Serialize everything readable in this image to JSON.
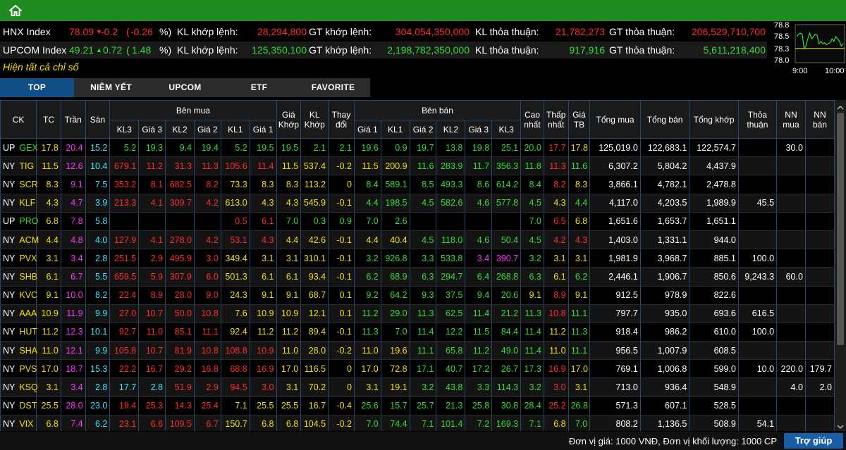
{
  "colors": {
    "up": "#33dd33",
    "down": "#ff2a2a",
    "ref": "#f0e000",
    "ceil": "#ff33ff",
    "floor": "#33e6ff",
    "neutral": "#ffffff",
    "accent": "#1f8a1f"
  },
  "icons": {
    "home": "home-icon"
  },
  "indices": [
    {
      "name": "HNX Index",
      "value": "78.09",
      "arrow": "▼",
      "change": "-0.2",
      "open_paren": "(",
      "pct": "-0.26",
      "pct_suffix": "%)",
      "kl_khop_label": "KL khớp lệnh:",
      "kl_khop": "28,294,800",
      "gt_khop_label": "GT khớp lệnh:",
      "gt_khop": "304,054,350,000",
      "kl_tt_label": "KL thỏa thuận:",
      "kl_tt": "21,782,273",
      "gt_tt_label": "GT thỏa thuận:",
      "gt_tt": "206,529,710,700",
      "dir": "down"
    },
    {
      "name": "UPCOM Index",
      "value": "49.21",
      "arrow": "▲",
      "change": "0.72",
      "open_paren": "(",
      "pct": "1.48",
      "pct_suffix": "%)",
      "kl_khop_label": "KL khớp lệnh:",
      "kl_khop": "125,350,100",
      "gt_khop_label": "GT khớp lệnh:",
      "gt_khop": "2,198,782,350,000",
      "kl_tt_label": "KL thỏa thuận:",
      "kl_tt": "917,916",
      "gt_tt_label": "GT thỏa thuận:",
      "gt_tt": "5,611,218,400",
      "dir": "up"
    }
  ],
  "show_all": "Hiện tất cả chỉ số",
  "mini_chart": {
    "y_labels": [
      "78.8",
      "78.5",
      "78.3",
      "78.0"
    ],
    "x_labels": [
      "9:00",
      "10:00"
    ],
    "series": [
      78.55,
      78.6,
      78.62,
      78.6,
      78.3,
      78.35,
      78.5,
      78.62,
      78.5,
      78.55,
      78.6,
      78.58,
      78.4,
      78.45,
      78.4,
      78.42,
      78.38,
      78.4,
      78.42,
      78.5,
      78.45,
      78.55,
      78.5,
      78.45,
      78.35,
      78.4
    ],
    "ref": 78.3,
    "y_range": [
      78.0,
      78.8
    ]
  },
  "tabs": [
    "TOP",
    "NIÊM YẾT",
    "UPCOM",
    "ETF",
    "FAVORITE"
  ],
  "headers": {
    "ck": "CK",
    "tc": "TC",
    "tran": "Trần",
    "san": "Sàn",
    "ben_mua": "Bên mua",
    "ben_ban": "Bên bán",
    "buy_sub": [
      "KL3",
      "Giá 3",
      "KL2",
      "Giá 2",
      "KL1",
      "Giá 1"
    ],
    "gia_khop": "Giá Khớp",
    "kl_khop": "KL Khớp",
    "thay_doi": "Thay đổi",
    "sell_sub": [
      "Giá 1",
      "KL1",
      "Giá 2",
      "KL2",
      "Giá 3",
      "KL3"
    ],
    "cao_nhat": "Cao nhất",
    "thap_nhat": "Thấp nhất",
    "gia_tb": "Giá TB",
    "tong_mua": "Tổng mua",
    "tong_ban": "Tổng bán",
    "tong_khop": "Tổng khớp",
    "thoa_thuan": "Thỏa thuận",
    "nn_mua": "NN mua",
    "nn_ban": "NN bán"
  },
  "rows": [
    {
      "ex": "UP",
      "ck": "GEX",
      "tc": "17.8",
      "tran": "20.4",
      "san": "15.2",
      "b": [
        "5.2",
        "19.3",
        "9.4",
        "19.4",
        "5.2",
        "19.5"
      ],
      "bc": [
        "g",
        "g",
        "g",
        "g",
        "g",
        "g"
      ],
      "gk": "19.5",
      "kk": "2.1",
      "td": "2.1",
      "kc": "g",
      "s": [
        "19.6",
        "0.9",
        "19.7",
        "13.8",
        "19.8",
        "25.1"
      ],
      "sc": [
        "g",
        "g",
        "g",
        "g",
        "g",
        "g"
      ],
      "cao": "20.0",
      "caoc": "g",
      "thap": "17.7",
      "thapc": "r",
      "tb": "17.8",
      "tbc": "y",
      "tm": "125,019.0",
      "tbn": "122,683.1",
      "tk": "122,574.7",
      "tt": "",
      "nm": "30.0",
      "nb": ""
    },
    {
      "ex": "NY",
      "ck": "TIG",
      "tc": "11.5",
      "tran": "12.6",
      "san": "10.4",
      "b": [
        "679.1",
        "11.2",
        "31.3",
        "11.3",
        "105.6",
        "11.4"
      ],
      "bc": [
        "r",
        "r",
        "r",
        "r",
        "r",
        "r"
      ],
      "gk": "11.5",
      "kk": "537.4",
      "td": "-0.2",
      "kc": "y",
      "s": [
        "11.5",
        "200.9",
        "11.6",
        "283.9",
        "11.7",
        "356.3"
      ],
      "sc": [
        "y",
        "y",
        "g",
        "g",
        "g",
        "g"
      ],
      "cao": "11.8",
      "caoc": "g",
      "thap": "11.3",
      "thapc": "r",
      "tb": "11.6",
      "tbc": "g",
      "tm": "6,307.2",
      "tbn": "5,804.2",
      "tk": "4,437.9",
      "tt": "",
      "nm": "",
      "nb": ""
    },
    {
      "ex": "NY",
      "ck": "SCR",
      "tc": "8.3",
      "tran": "9.1",
      "san": "7.5",
      "b": [
        "353.2",
        "8.1",
        "682.5",
        "8.2",
        "73.3",
        "8.3"
      ],
      "bc": [
        "r",
        "r",
        "r",
        "r",
        "y",
        "y"
      ],
      "gk": "8.3",
      "kk": "113.2",
      "td": "0",
      "kc": "y",
      "s": [
        "8.4",
        "589.1",
        "8.5",
        "493.3",
        "8.6",
        "614.2"
      ],
      "sc": [
        "g",
        "g",
        "g",
        "g",
        "g",
        "g"
      ],
      "cao": "8.4",
      "caoc": "g",
      "thap": "8.2",
      "thapc": "r",
      "tb": "8.3",
      "tbc": "y",
      "tm": "3,866.1",
      "tbn": "4,782.1",
      "tk": "2,478.8",
      "tt": "",
      "nm": "",
      "nb": ""
    },
    {
      "ex": "NY",
      "ck": "KLF",
      "tc": "4.3",
      "tran": "4.7",
      "san": "3.9",
      "b": [
        "213.3",
        "4.1",
        "309.7",
        "4.2",
        "613.0",
        "4.3"
      ],
      "bc": [
        "r",
        "r",
        "r",
        "r",
        "y",
        "y"
      ],
      "gk": "4.3",
      "kk": "545.9",
      "td": "-0.1",
      "kc": "y",
      "s": [
        "4.4",
        "198.5",
        "4.5",
        "582.6",
        "4.6",
        "577.8"
      ],
      "sc": [
        "g",
        "g",
        "g",
        "g",
        "g",
        "g"
      ],
      "cao": "4.5",
      "caoc": "g",
      "thap": "4.3",
      "thapc": "y",
      "tb": "4.4",
      "tbc": "g",
      "tm": "4,117.0",
      "tbn": "4,203.5",
      "tk": "1,989.9",
      "tt": "45.5",
      "nm": "",
      "nb": ""
    },
    {
      "ex": "UP",
      "ck": "PRO",
      "tc": "6.8",
      "tran": "7.8",
      "san": "5.8",
      "b": [
        "",
        "",
        "",
        "",
        "0.5",
        "6.1"
      ],
      "bc": [
        "r",
        "r",
        "r",
        "r",
        "r",
        "r"
      ],
      "gk": "7.0",
      "kk": "0.3",
      "td": "0.9",
      "kc": "g",
      "s": [
        "7.0",
        "2.6",
        "",
        "",
        "",
        ""
      ],
      "sc": [
        "g",
        "g",
        "g",
        "g",
        "g",
        "g"
      ],
      "cao": "7.0",
      "caoc": "g",
      "thap": "6.5",
      "thapc": "r",
      "tb": "6.8",
      "tbc": "y",
      "tm": "1,651.6",
      "tbn": "1,653.7",
      "tk": "1,651.1",
      "tt": "",
      "nm": "",
      "nb": ""
    },
    {
      "ex": "NY",
      "ck": "ACM",
      "tc": "4.4",
      "tran": "4.8",
      "san": "4.0",
      "b": [
        "127.9",
        "4.1",
        "278.0",
        "4.2",
        "53.1",
        "4.3"
      ],
      "bc": [
        "r",
        "r",
        "r",
        "r",
        "r",
        "r"
      ],
      "gk": "4.4",
      "kk": "42.6",
      "td": "-0.1",
      "kc": "y",
      "s": [
        "4.4",
        "40.4",
        "4.5",
        "118.0",
        "4.6",
        "50.4"
      ],
      "sc": [
        "y",
        "y",
        "g",
        "g",
        "g",
        "g"
      ],
      "cao": "4.5",
      "caoc": "g",
      "thap": "4.2",
      "thapc": "r",
      "tb": "4.3",
      "tbc": "r",
      "tm": "1,403.0",
      "tbn": "1,331.1",
      "tk": "944.0",
      "tt": "",
      "nm": "",
      "nb": ""
    },
    {
      "ex": "NY",
      "ck": "PVX",
      "tc": "3.1",
      "tran": "3.4",
      "san": "2.8",
      "b": [
        "251.5",
        "2.9",
        "495.9",
        "3.0",
        "349.4",
        "3.1"
      ],
      "bc": [
        "r",
        "r",
        "r",
        "r",
        "y",
        "y"
      ],
      "gk": "3.1",
      "kk": "310.1",
      "td": "-0.1",
      "kc": "y",
      "s": [
        "3.2",
        "926.8",
        "3.3",
        "533.8",
        "3.4",
        "390.7"
      ],
      "sc": [
        "g",
        "g",
        "g",
        "g",
        "m",
        "m"
      ],
      "cao": "3.2",
      "caoc": "g",
      "thap": "3.1",
      "thapc": "y",
      "tb": "3.1",
      "tbc": "y",
      "tm": "1,981.9",
      "tbn": "3,968.7",
      "tk": "885.1",
      "tt": "100.0",
      "nm": "",
      "nb": ""
    },
    {
      "ex": "NY",
      "ck": "SHB",
      "tc": "6.1",
      "tran": "6.7",
      "san": "5.5",
      "b": [
        "659.5",
        "5.9",
        "307.9",
        "6.0",
        "501.3",
        "6.1"
      ],
      "bc": [
        "r",
        "r",
        "r",
        "r",
        "y",
        "y"
      ],
      "gk": "6.1",
      "kk": "93.4",
      "td": "-0.1",
      "kc": "y",
      "s": [
        "6.2",
        "68.9",
        "6.3",
        "294.7",
        "6.4",
        "268.8"
      ],
      "sc": [
        "g",
        "g",
        "g",
        "g",
        "g",
        "g"
      ],
      "cao": "6.3",
      "caoc": "g",
      "thap": "6.1",
      "thapc": "y",
      "tb": "6.2",
      "tbc": "g",
      "tm": "2,446.1",
      "tbn": "1,906.7",
      "tk": "850.6",
      "tt": "9,243.3",
      "nm": "60.0",
      "nb": ""
    },
    {
      "ex": "NY",
      "ck": "KVC",
      "tc": "9.1",
      "tran": "10.0",
      "san": "8.2",
      "b": [
        "22.4",
        "8.9",
        "28.0",
        "9.0",
        "24.3",
        "9.1"
      ],
      "bc": [
        "r",
        "r",
        "r",
        "r",
        "y",
        "y"
      ],
      "gk": "9.1",
      "kk": "68.7",
      "td": "0.1",
      "kc": "y",
      "s": [
        "9.2",
        "64.2",
        "9.3",
        "37.5",
        "9.4",
        "20.6"
      ],
      "sc": [
        "g",
        "g",
        "g",
        "g",
        "g",
        "g"
      ],
      "cao": "9.1",
      "caoc": "y",
      "thap": "8.9",
      "thapc": "r",
      "tb": "9.1",
      "tbc": "y",
      "tm": "912.5",
      "tbn": "978.9",
      "tk": "822.6",
      "tt": "",
      "nm": "",
      "nb": ""
    },
    {
      "ex": "NY",
      "ck": "AAA",
      "tc": "10.9",
      "tran": "11.9",
      "san": "9.9",
      "b": [
        "27.0",
        "10.7",
        "50.0",
        "10.8",
        "7.6",
        "10.9"
      ],
      "bc": [
        "r",
        "r",
        "r",
        "r",
        "y",
        "y"
      ],
      "gk": "10.9",
      "kk": "12.1",
      "td": "0.1",
      "kc": "y",
      "s": [
        "11.2",
        "29.0",
        "11.3",
        "62.5",
        "11.4",
        "21.2"
      ],
      "sc": [
        "g",
        "g",
        "g",
        "g",
        "g",
        "g"
      ],
      "cao": "11.3",
      "caoc": "g",
      "thap": "10.8",
      "thapc": "r",
      "tb": "11.1",
      "tbc": "g",
      "tm": "797.7",
      "tbn": "935.0",
      "tk": "693.6",
      "tt": "616.5",
      "nm": "",
      "nb": ""
    },
    {
      "ex": "NY",
      "ck": "HUT",
      "tc": "11.2",
      "tran": "12.3",
      "san": "10.1",
      "b": [
        "92.7",
        "11.0",
        "85.1",
        "11.1",
        "92.4",
        "11.2"
      ],
      "bc": [
        "r",
        "r",
        "r",
        "r",
        "y",
        "y"
      ],
      "gk": "11.2",
      "kk": "89.4",
      "td": "-0.1",
      "kc": "y",
      "s": [
        "11.3",
        "7.0",
        "11.4",
        "12.2",
        "11.5",
        "84.4"
      ],
      "sc": [
        "g",
        "g",
        "g",
        "g",
        "g",
        "g"
      ],
      "cao": "11.4",
      "caoc": "g",
      "thap": "11.2",
      "thapc": "y",
      "tb": "11.3",
      "tbc": "g",
      "tm": "918.4",
      "tbn": "986.2",
      "tk": "610.0",
      "tt": "100.0",
      "nm": "",
      "nb": ""
    },
    {
      "ex": "NY",
      "ck": "SHA",
      "tc": "11.0",
      "tran": "12.1",
      "san": "9.9",
      "b": [
        "105.8",
        "10.7",
        "81.9",
        "10.8",
        "108.8",
        "10.9"
      ],
      "bc": [
        "r",
        "r",
        "r",
        "r",
        "r",
        "r"
      ],
      "gk": "11.0",
      "kk": "28.0",
      "td": "-0.2",
      "kc": "y",
      "s": [
        "11.0",
        "19.6",
        "11.1",
        "65.8",
        "11.2",
        "49.0"
      ],
      "sc": [
        "y",
        "y",
        "g",
        "g",
        "g",
        "g"
      ],
      "cao": "11.4",
      "caoc": "g",
      "thap": "11.0",
      "thapc": "y",
      "tb": "11.1",
      "tbc": "g",
      "tm": "956.5",
      "tbn": "1,007.9",
      "tk": "608.5",
      "tt": "",
      "nm": "",
      "nb": ""
    },
    {
      "ex": "NY",
      "ck": "PVS",
      "tc": "17.0",
      "tran": "18.7",
      "san": "15.3",
      "b": [
        "22.2",
        "16.7",
        "29.2",
        "16.8",
        "68.8",
        "16.9"
      ],
      "bc": [
        "r",
        "r",
        "r",
        "r",
        "r",
        "r"
      ],
      "gk": "17.0",
      "kk": "116.5",
      "td": "0",
      "kc": "y",
      "s": [
        "17.0",
        "72.8",
        "17.1",
        "40.7",
        "17.2",
        "26.7"
      ],
      "sc": [
        "y",
        "y",
        "g",
        "g",
        "g",
        "g"
      ],
      "cao": "17.3",
      "caoc": "g",
      "thap": "16.9",
      "thapc": "r",
      "tb": "17.0",
      "tbc": "y",
      "tm": "769.1",
      "tbn": "1,006.8",
      "tk": "599.0",
      "tt": "10.0",
      "nm": "220.0",
      "nb": "179.7"
    },
    {
      "ex": "NY",
      "ck": "KSQ",
      "tc": "3.1",
      "tran": "3.4",
      "san": "2.8",
      "b": [
        "17.7",
        "2.8",
        "51.9",
        "2.9",
        "94.5",
        "3.0"
      ],
      "bc": [
        "c",
        "c",
        "r",
        "r",
        "r",
        "r"
      ],
      "gk": "3.1",
      "kk": "70.2",
      "td": "0",
      "kc": "y",
      "s": [
        "3.1",
        "19.1",
        "3.2",
        "43.8",
        "3.3",
        "114.3"
      ],
      "sc": [
        "y",
        "y",
        "g",
        "g",
        "g",
        "g"
      ],
      "cao": "3.2",
      "caoc": "g",
      "thap": "3.0",
      "thapc": "r",
      "tb": "3.1",
      "tbc": "y",
      "tm": "713.0",
      "tbn": "936.4",
      "tk": "548.9",
      "tt": "",
      "nm": "4.0",
      "nb": "2.0"
    },
    {
      "ex": "NY",
      "ck": "DST",
      "tc": "25.5",
      "tran": "28.0",
      "san": "23.0",
      "b": [
        "19.4",
        "25.3",
        "14.3",
        "25.4",
        "7.1",
        "25.5"
      ],
      "bc": [
        "r",
        "r",
        "r",
        "r",
        "y",
        "y"
      ],
      "gk": "25.5",
      "kk": "16.7",
      "td": "-0.4",
      "kc": "y",
      "s": [
        "25.6",
        "15.7",
        "25.7",
        "21.3",
        "25.8",
        "30.8"
      ],
      "sc": [
        "g",
        "g",
        "g",
        "g",
        "g",
        "g"
      ],
      "cao": "28.4",
      "caoc": "g",
      "thap": "25.2",
      "thapc": "r",
      "tb": "26.8",
      "tbc": "g",
      "tm": "571.3",
      "tbn": "607.1",
      "tk": "528.5",
      "tt": "",
      "nm": "",
      "nb": ""
    },
    {
      "ex": "NY",
      "ck": "VIX",
      "tc": "6.8",
      "tran": "7.4",
      "san": "6.2",
      "b": [
        "23.1",
        "6.6",
        "109.5",
        "6.7",
        "150.7",
        "6.8"
      ],
      "bc": [
        "r",
        "r",
        "r",
        "r",
        "y",
        "y"
      ],
      "gk": "6.8",
      "kk": "104.5",
      "td": "-0.2",
      "kc": "y",
      "s": [
        "7.0",
        "74.4",
        "7.1",
        "101.4",
        "7.2",
        "169.3"
      ],
      "sc": [
        "g",
        "g",
        "g",
        "g",
        "g",
        "g"
      ],
      "cao": "7.1",
      "caoc": "g",
      "thap": "6.8",
      "thapc": "y",
      "tb": "7.0",
      "tbc": "g",
      "tm": "808.2",
      "tbn": "1,136.5",
      "tk": "508.9",
      "tt": "54.1",
      "nm": "",
      "nb": ""
    }
  ],
  "footer": {
    "unit_note": "Đơn vị giá: 1000 VNĐ, Đơn vị khối lượng: 1000 CP",
    "help": "Trợ giúp"
  }
}
